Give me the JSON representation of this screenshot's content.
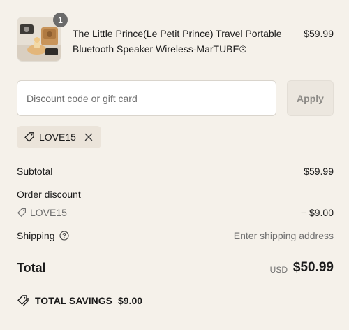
{
  "product": {
    "title": "The Little Prince(Le Petit Prince) Travel Portable Bluetooth Speaker Wireless-MarTUBE®",
    "price": "$59.99",
    "quantity": "1",
    "image_icon": "product-image"
  },
  "discount": {
    "placeholder": "Discount code or gift card",
    "value": "",
    "apply_label": "Apply",
    "applied_code": "LOVE15"
  },
  "summary": {
    "subtotal_label": "Subtotal",
    "subtotal_value": "$59.99",
    "order_discount_label": "Order discount",
    "discount_code": "LOVE15",
    "discount_value": "− $9.00",
    "shipping_label": "Shipping",
    "shipping_value": "Enter shipping address",
    "total_label": "Total",
    "total_currency": "USD",
    "total_value": "$50.99",
    "savings_label": "TOTAL SAVINGS",
    "savings_value": "$9.00"
  },
  "colors": {
    "background": "#f5f1ea",
    "chip_background": "#ebe4da",
    "badge": "#6b6b6b"
  }
}
